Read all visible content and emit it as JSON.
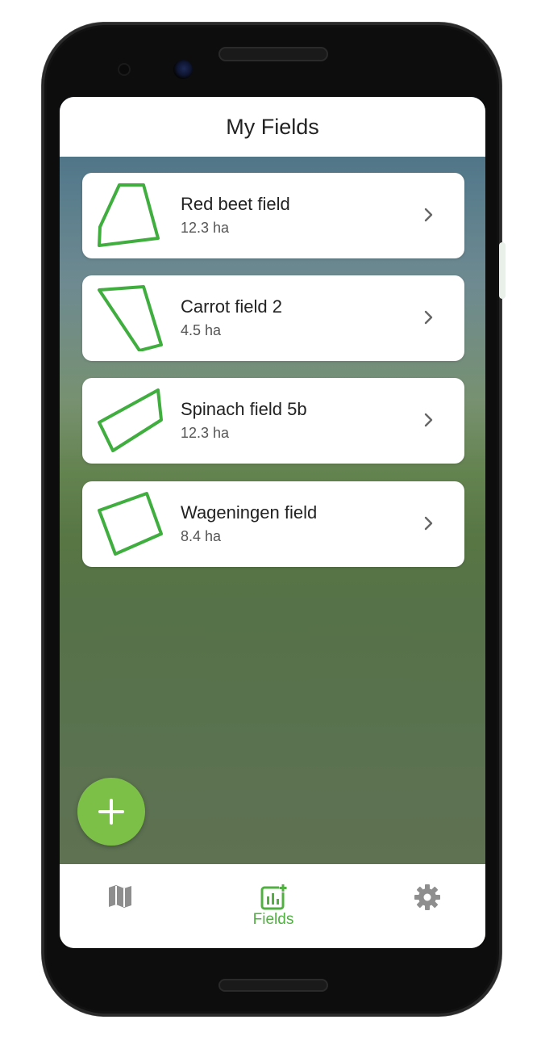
{
  "header": {
    "title": "My Fields"
  },
  "fields": [
    {
      "name": "Red beet field",
      "area": "12.3 ha",
      "shape_icon": "red-beet-polygon-icon"
    },
    {
      "name": "Carrot field 2",
      "area": "4.5 ha",
      "shape_icon": "carrot-polygon-icon"
    },
    {
      "name": "Spinach field 5b",
      "area": "12.3 ha",
      "shape_icon": "spinach-polygon-icon"
    },
    {
      "name": "Wageningen field",
      "area": "8.4 ha",
      "shape_icon": "wageningen-polygon-icon"
    }
  ],
  "fab": {
    "icon": "plus-icon"
  },
  "tabbar": {
    "tabs": [
      {
        "id": "map",
        "icon": "map-icon",
        "label": ""
      },
      {
        "id": "fields",
        "icon": "fields-chart-icon",
        "label": "Fields",
        "active": true
      },
      {
        "id": "settings",
        "icon": "gear-icon",
        "label": ""
      }
    ]
  },
  "colors": {
    "accent": "#7cc047",
    "active_tab": "#52b043",
    "field_outline": "#3fae3f",
    "inactive_icon": "#8e8e8e"
  }
}
